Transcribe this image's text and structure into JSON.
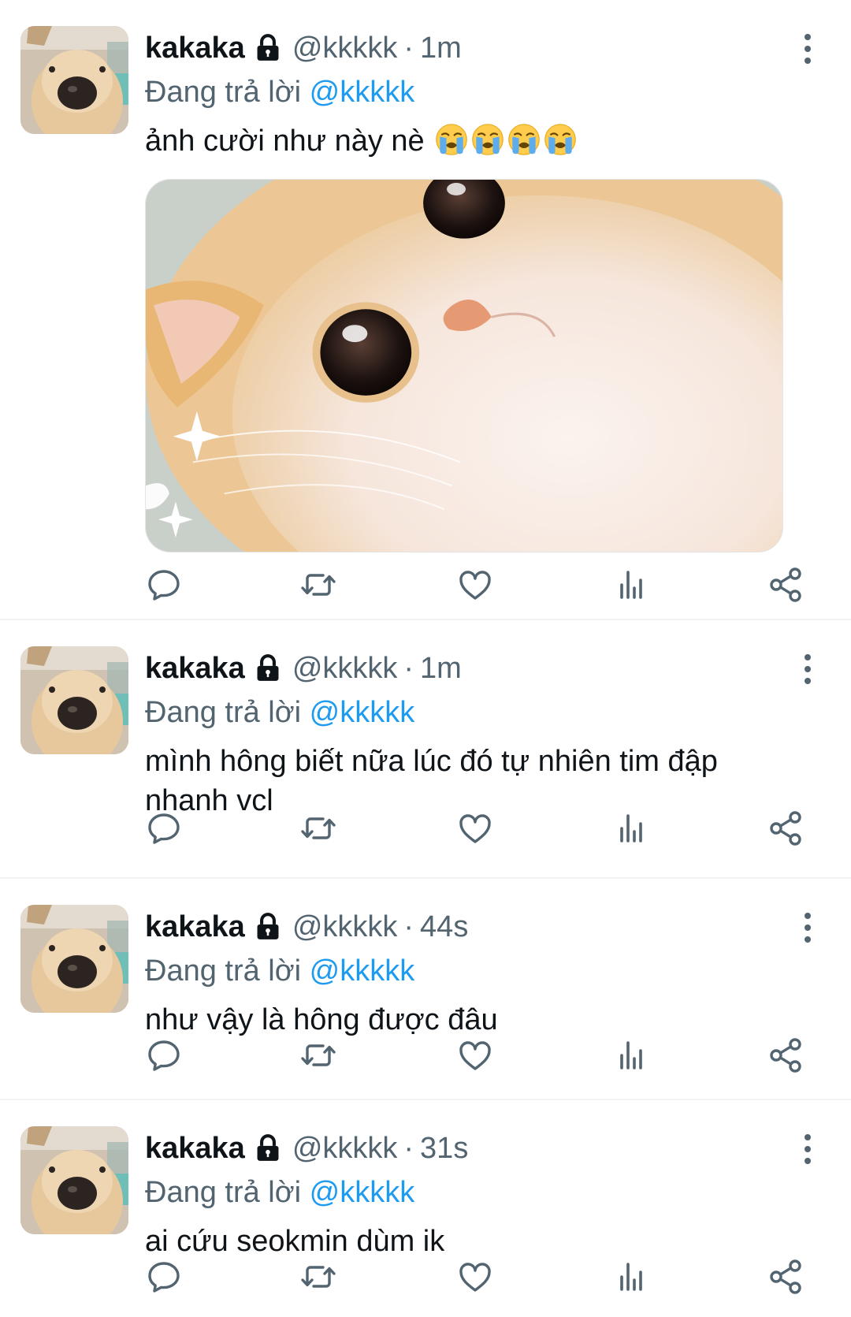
{
  "tweets": [
    {
      "name": "kakaka",
      "handle": "@kkkkk",
      "separator": "·",
      "time": "1m",
      "reply_prefix": "Đang trả lời",
      "reply_to": "@kkkkk",
      "text": "ảnh cười như này nè",
      "emojis": [
        "loudly-crying-face",
        "loudly-crying-face",
        "loudly-crying-face",
        "loudly-crying-face"
      ],
      "has_media": true
    },
    {
      "name": "kakaka",
      "handle": "@kkkkk",
      "separator": "·",
      "time": "1m",
      "reply_prefix": "Đang trả lời",
      "reply_to": "@kkkkk",
      "text": "mình hông biết nữa lúc đó tự nhiên tim đập nhanh vcl"
    },
    {
      "name": "kakaka",
      "handle": "@kkkkk",
      "separator": "·",
      "time": "44s",
      "reply_prefix": "Đang trả lời",
      "reply_to": "@kkkkk",
      "text": "như vậy là hông được đâu"
    },
    {
      "name": "kakaka",
      "handle": "@kkkkk",
      "separator": "·",
      "time": "31s",
      "reply_prefix": "Đang trả lời",
      "reply_to": "@kkkkk",
      "text": "ai cứu seokmin dùm ik"
    }
  ],
  "icons": {
    "account": "lock-icon",
    "more": "more-vertical-icon",
    "actions": [
      "reply-icon",
      "retweet-icon",
      "like-icon",
      "analytics-icon",
      "share-icon"
    ]
  },
  "colors": {
    "link": "#1d9bf0",
    "secondary_text": "#536471",
    "primary_text": "#0f1419",
    "divider": "#eff3f4"
  }
}
